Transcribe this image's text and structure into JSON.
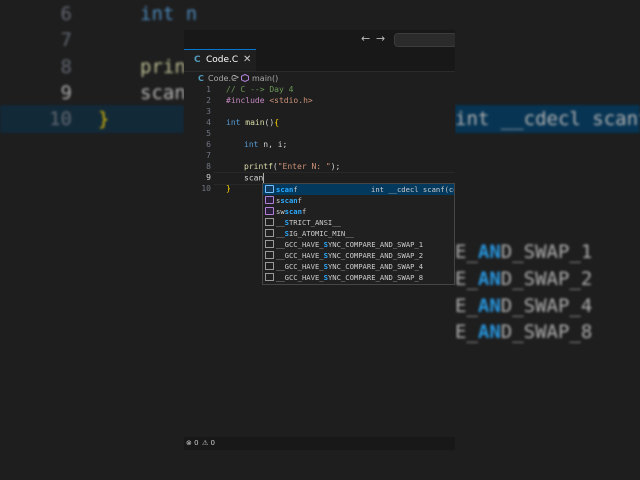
{
  "background": {
    "line_numbers": [
      "6",
      "7",
      "8",
      "9",
      "10"
    ],
    "code": [
      "int n",
      "",
      "print",
      "scan",
      "}"
    ],
    "suggestion_detail": "int __cdecl scanf(cons",
    "suggestions": [
      {
        "pre": "E_",
        "match": "AN",
        "mid": "D_SWAP_1"
      },
      {
        "pre": "E_",
        "match": "AN",
        "mid": "D_SWAP_2"
      },
      {
        "pre": "E_",
        "match": "AN",
        "mid": "D_SWAP_4"
      },
      {
        "pre": "E_",
        "match": "AN",
        "mid": "D_SWAP_8"
      }
    ]
  },
  "titlebar": {
    "back_label": "←",
    "forward_label": "→"
  },
  "tab": {
    "icon_letter": "C",
    "label": "Code.C",
    "close_label": "✕"
  },
  "breadcrumb": {
    "file_icon_letter": "C",
    "file": "Code.C",
    "separator": ">",
    "symbol": "main()"
  },
  "editor": {
    "line_numbers": [
      "1",
      "2",
      "3",
      "4",
      "5",
      "6",
      "7",
      "8",
      "9",
      "10"
    ],
    "current_line": "9",
    "lines": {
      "l1": "// C --> Day 4",
      "l2_directive": "#include",
      "l2_header": " <stdio.h>",
      "l4_type": "int",
      "l4_name": " main",
      "l4_paren": "()",
      "l4_brace": "{",
      "l6_type": "int",
      "l6_rest": " n, i;",
      "l8_fn": "printf",
      "l8_open": "(",
      "l8_str": "\"Enter N: \"",
      "l8_close": ");",
      "l9_text": "scan",
      "l10_brace": "}"
    }
  },
  "autocomplete": {
    "items": [
      {
        "kind": "function",
        "pre": "",
        "match": "scan",
        "post": "f",
        "detail": "int __cdecl scanf(cons",
        "selected": true
      },
      {
        "kind": "function",
        "pre": "s",
        "match": "scan",
        "post": "f",
        "detail": "",
        "selected": false
      },
      {
        "kind": "function",
        "pre": "sw",
        "match": "scan",
        "post": "f",
        "detail": "",
        "selected": false
      },
      {
        "kind": "keyword",
        "pre": "__",
        "match": "S",
        "post": "TRICT_ANSI__",
        "detail": "",
        "selected": false
      },
      {
        "kind": "keyword",
        "pre": "__",
        "match": "S",
        "post": "IG_ATOMIC_MIN__",
        "detail": "",
        "selected": false
      },
      {
        "kind": "keyword",
        "pre": "__GCC_HAVE_",
        "match": "S",
        "post": "YNC_COMPARE_AND_SWAP_1",
        "detail": "",
        "selected": false
      },
      {
        "kind": "keyword",
        "pre": "__GCC_HAVE_",
        "match": "S",
        "post": "YNC_COMPARE_AND_SWAP_2",
        "detail": "",
        "selected": false
      },
      {
        "kind": "keyword",
        "pre": "__GCC_HAVE_",
        "match": "S",
        "post": "YNC_COMPARE_AND_SWAP_4",
        "detail": "",
        "selected": false
      },
      {
        "kind": "keyword",
        "pre": "__GCC_HAVE_",
        "match": "S",
        "post": "YNC_COMPARE_AND_SWAP_8",
        "detail": "",
        "selected": false
      }
    ]
  },
  "statusbar": {
    "errors_icon": "⊗",
    "errors": "0",
    "warnings_icon": "⚠",
    "warnings": "0"
  },
  "colors": {
    "accent": "#0078d4",
    "selection": "#04395e",
    "match_highlight": "#2aaaff"
  }
}
